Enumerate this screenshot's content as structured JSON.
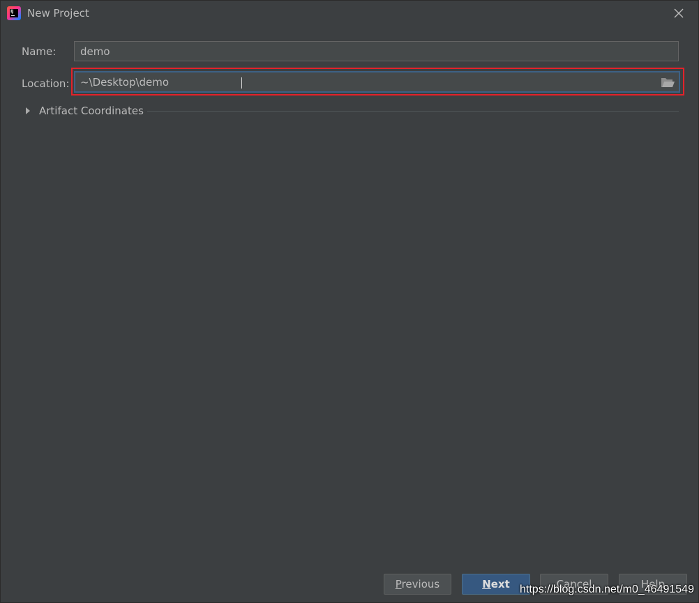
{
  "window": {
    "title": "New Project",
    "app_icon": "intellij-idea-icon",
    "close_icon": "close-icon"
  },
  "form": {
    "name_label": "Name:",
    "name_value": "demo",
    "location_label": "Location:",
    "location_value": "~\\Desktop\\demo",
    "browse_icon": "folder-open-icon",
    "artifact_section_label": "Artifact Coordinates",
    "artifact_expanded": false
  },
  "buttons": {
    "previous_mnemonic": "P",
    "previous_rest": "revious",
    "next_mnemonic": "N",
    "next_rest": "ext",
    "cancel_label": "Cancel",
    "help_label": "Help"
  },
  "watermark": "https://blog.csdn.net/m0_46491549",
  "colors": {
    "background": "#3c3f41",
    "input_background": "#45494a",
    "focus_border": "#3d6185",
    "highlight_annotation": "#e3222a",
    "primary_button": "#365880"
  }
}
